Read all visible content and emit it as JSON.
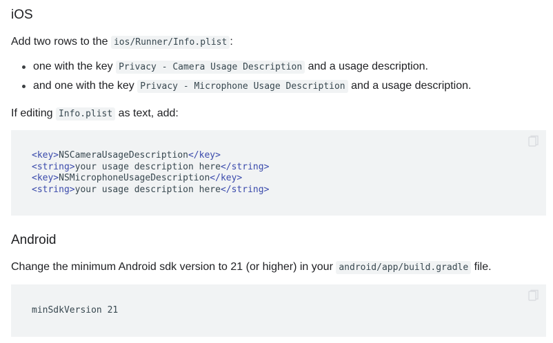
{
  "ios": {
    "heading": "iOS",
    "add_rows": {
      "text_before": "Add two rows to the ",
      "code": "ios/Runner/Info.plist",
      "text_after": ":"
    },
    "bullets": [
      {
        "text_before": "one with the key ",
        "code": "Privacy - Camera Usage Description",
        "text_after": " and a usage description."
      },
      {
        "text_before": "and one with the key ",
        "code": "Privacy - Microphone Usage Description",
        "text_after": " and a usage description."
      }
    ],
    "editing": {
      "text_before": "If editing ",
      "code": "Info.plist",
      "text_after": " as text, add:"
    },
    "code_lines": [
      {
        "open": "<key>",
        "value": "NSCameraUsageDescription",
        "close": "</key>"
      },
      {
        "open": "<string>",
        "value": "your usage description here",
        "close": "</string>"
      },
      {
        "open": "<key>",
        "value": "NSMicrophoneUsageDescription",
        "close": "</key>"
      },
      {
        "open": "<string>",
        "value": "your usage description here",
        "close": "</string>"
      }
    ]
  },
  "android": {
    "heading": "Android",
    "change": {
      "text_before": "Change the minimum Android sdk version to 21 (or higher) in your ",
      "code": "android/app/build.gradle",
      "text_after": " file."
    },
    "code": "minSdkVersion 21"
  },
  "icons": {
    "copy": "copy-icon"
  },
  "colors": {
    "code_background": "#f1f3f4",
    "xml_tag": "#3949ab",
    "code_text": "#37474f"
  }
}
